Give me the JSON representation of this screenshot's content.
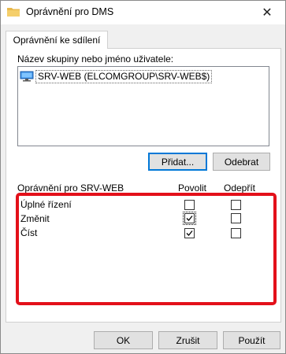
{
  "window": {
    "title": "Oprávnění pro DMS",
    "close_glyph": "✕"
  },
  "tabs": [
    {
      "label": "Oprávnění ke sdílení",
      "active": true
    }
  ],
  "group_section": {
    "label": "Název skupiny nebo jméno uživatele:",
    "items": [
      {
        "name": "SRV-WEB (ELCOMGROUP\\SRV-WEB$)",
        "icon": "computer-icon",
        "selected": true
      }
    ]
  },
  "buttons": {
    "add": "Přidat...",
    "remove": "Odebrat"
  },
  "permissions": {
    "header": "Oprávnění pro SRV-WEB",
    "allow_header": "Povolit",
    "deny_header": "Odepřít",
    "rows": [
      {
        "label": "Úplné řízení",
        "allow": false,
        "deny": false
      },
      {
        "label": "Změnit",
        "allow": true,
        "deny": false
      },
      {
        "label": "Číst",
        "allow": true,
        "deny": false
      }
    ]
  },
  "footer": {
    "ok": "OK",
    "cancel": "Zrušit",
    "apply": "Použít"
  },
  "colors": {
    "highlight": "#e3101a",
    "accent": "#0078d7",
    "folder": "#e8b84a"
  }
}
